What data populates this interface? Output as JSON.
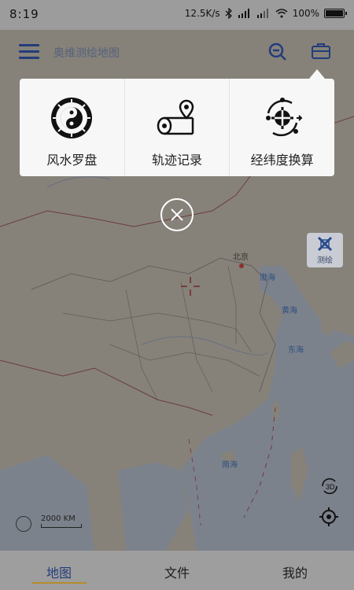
{
  "status_bar": {
    "time": "8:19",
    "net_speed": "12.5K/s",
    "battery": "100%"
  },
  "app": {
    "title": "奥维测绘地图"
  },
  "tools_popup": {
    "items": [
      {
        "label": "风水罗盘",
        "icon": "fengshui-compass-icon"
      },
      {
        "label": "轨迹记录",
        "icon": "track-record-icon"
      },
      {
        "label": "经纬度换算",
        "icon": "coordinate-convert-icon"
      }
    ]
  },
  "map": {
    "labels": {
      "beijing": "北京",
      "bohai": "渤海",
      "huanghai": "黄海",
      "donghai": "东海",
      "nanhai": "南海"
    },
    "survey_button": "测绘",
    "scale": "2000 KM"
  },
  "bottom_nav": {
    "tabs": [
      {
        "label": "地图",
        "active": true
      },
      {
        "label": "文件",
        "active": false
      },
      {
        "label": "我的",
        "active": false
      }
    ]
  },
  "colors": {
    "accent": "#233c7a",
    "active_underline": "#b68c2c",
    "sea": "#aab3c2",
    "land": "#b9b3a6"
  }
}
